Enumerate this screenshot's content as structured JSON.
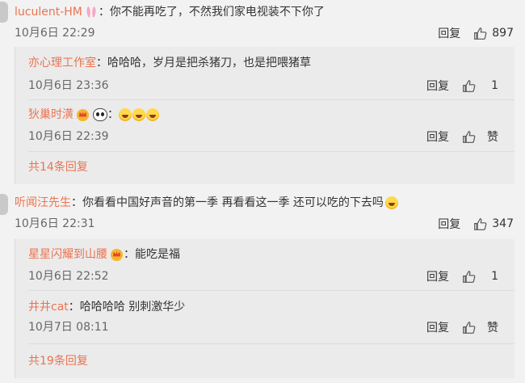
{
  "comments": [
    {
      "username": "luculent-HM",
      "text": "你不能再吃了，不然我们家电视装不下你了",
      "time": "10月6日 22:29",
      "reply_label": "回复",
      "likes": "897",
      "badge_icon": "bunny-ears-icon",
      "replies": [
        {
          "username": "亦心理工作室",
          "text": "哈哈哈，岁月是把杀猪刀，也是把喂猪草",
          "time": "10月6日 23:36",
          "reply_label": "回复",
          "likes": "1"
        },
        {
          "username": "狄巢时潢",
          "text": "",
          "emoji_icons": [
            "panda-icon",
            "laughing-tears-emoji",
            "laughing-tears-emoji",
            "laughing-tears-emoji"
          ],
          "time": "10月6日 22:39",
          "reply_label": "回复",
          "likes": "赞"
        }
      ],
      "more_replies": "共14条回复"
    },
    {
      "username": "听闻汪先生",
      "text": "你看看中国好声音的第一季 再看看这一季 还可以吃的下去吗",
      "time": "10月6日 22:31",
      "reply_label": "回复",
      "likes": "347",
      "replies": [
        {
          "username": "星星闪耀到山腰",
          "text": "能吃是福",
          "time": "10月6日 22:52",
          "reply_label": "回复",
          "likes": "1"
        },
        {
          "username": "井井cat",
          "text": "哈哈哈哈 别刺激华少",
          "time": "10月7日 08:11",
          "reply_label": "回复",
          "likes": "赞"
        }
      ],
      "more_replies": "共19条回复"
    }
  ],
  "colors": {
    "username": "#eb7350",
    "background": "#f2f2f2",
    "subpanel": "#ebebeb"
  }
}
